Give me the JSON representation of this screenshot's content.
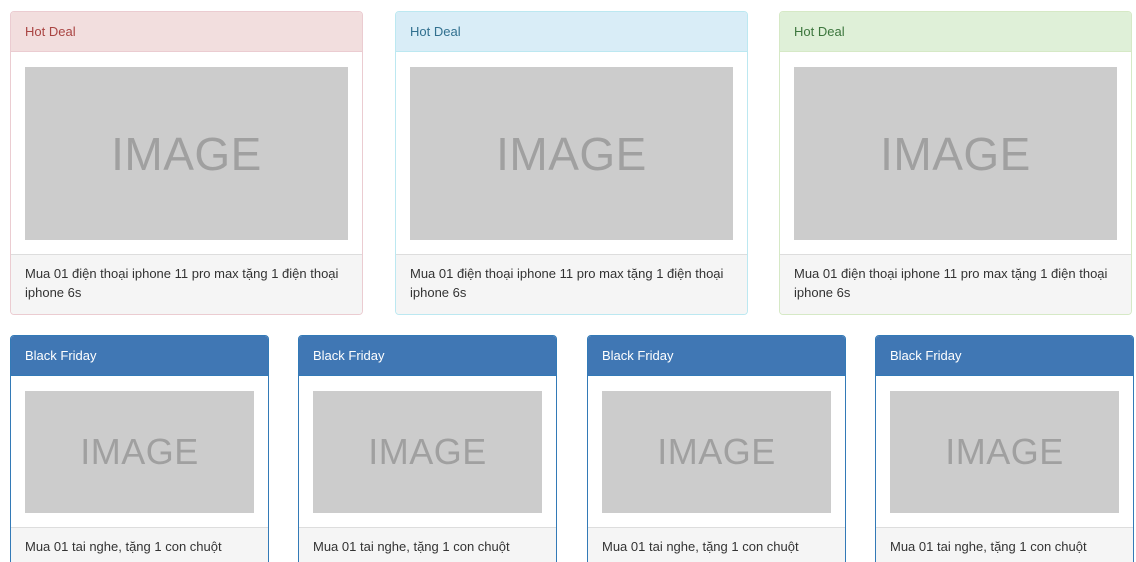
{
  "hot_deals": [
    {
      "heading": "Hot Deal",
      "image_text": "IMAGE",
      "description": "Mua 01 điện thoại iphone 11 pro max tặng 1 điện thoại iphone 6s",
      "variant": "danger"
    },
    {
      "heading": "Hot Deal",
      "image_text": "IMAGE",
      "description": "Mua 01 điện thoại iphone 11 pro max tặng 1 điện thoại iphone 6s",
      "variant": "info"
    },
    {
      "heading": "Hot Deal",
      "image_text": "IMAGE",
      "description": "Mua 01 điện thoại iphone 11 pro max tặng 1 điện thoại iphone 6s",
      "variant": "success"
    }
  ],
  "black_friday": [
    {
      "heading": "Black Friday",
      "image_text": "IMAGE",
      "description": "Mua 01 tai nghe, tặng 1 con chuột"
    },
    {
      "heading": "Black Friday",
      "image_text": "IMAGE",
      "description": "Mua 01 tai nghe, tặng 1 con chuột"
    },
    {
      "heading": "Black Friday",
      "image_text": "IMAGE",
      "description": "Mua 01 tai nghe, tặng 1 con chuột"
    },
    {
      "heading": "Black Friday",
      "image_text": "IMAGE",
      "description": "Mua 01 tai nghe, tặng 1 con chuột"
    }
  ],
  "colors": {
    "danger_heading_bg": "#f2dede",
    "info_heading_bg": "#d9edf7",
    "success_heading_bg": "#dff0d8",
    "primary_heading_bg": "#4077b4",
    "image_placeholder_bg": "#cccccc"
  }
}
